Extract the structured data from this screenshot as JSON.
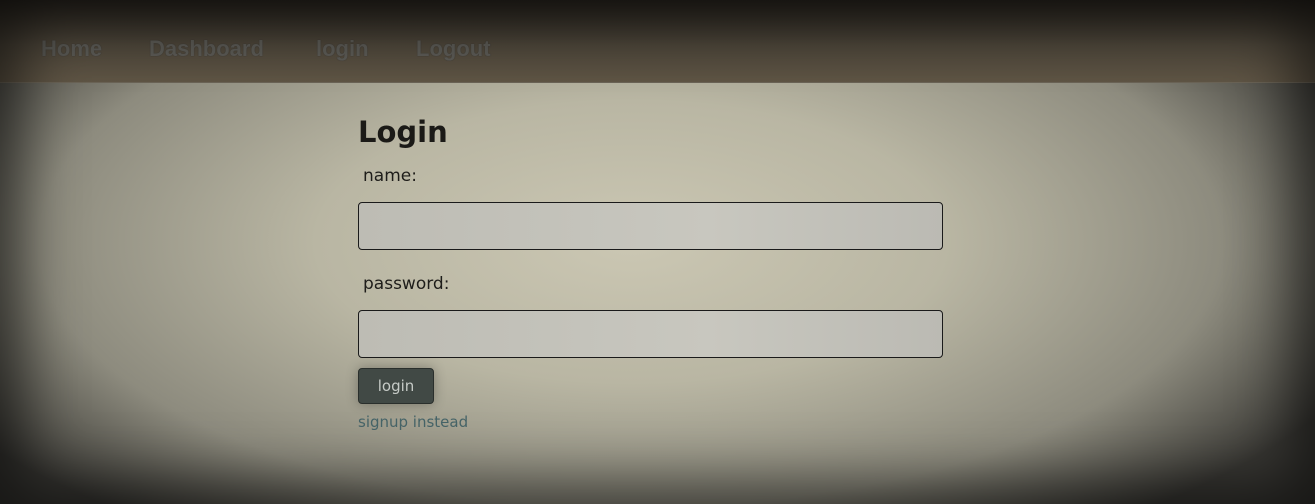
{
  "nav": {
    "items": [
      "Home",
      "Dashboard",
      "login",
      "Logout"
    ]
  },
  "form": {
    "title": "Login",
    "name_label": "name:",
    "name_value": "",
    "password_label": "password:",
    "password_value": "",
    "submit_label": "login",
    "signup_link": "signup instead"
  }
}
